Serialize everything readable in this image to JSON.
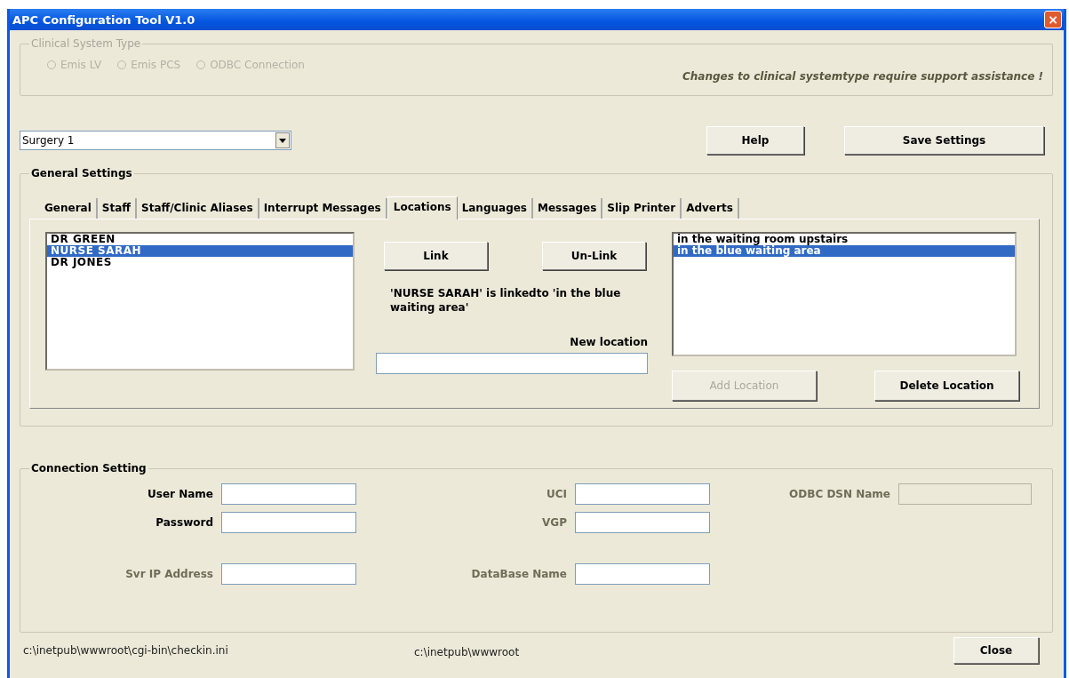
{
  "window": {
    "title": "APC Configuration Tool V1.0",
    "close": "×"
  },
  "clinical_system_type": {
    "legend": "Clinical System Type",
    "options": [
      {
        "label": "Emis LV",
        "selected": false,
        "disabled": true
      },
      {
        "label": "Emis PCS",
        "selected": false,
        "disabled": true
      },
      {
        "label": "ODBC Connection",
        "selected": false,
        "disabled": true
      }
    ],
    "note": "Changes to clinical systemtype require support assistance !"
  },
  "surgery": {
    "value": "Surgery 1"
  },
  "buttons": [
    {
      "label": "Help",
      "disabled": false
    },
    {
      "label": "Save Settings",
      "disabled": false
    }
  ],
  "general_settings": {
    "legend": "General Settings",
    "tabs": [
      {
        "label": "General",
        "selected": false
      },
      {
        "label": "Staff",
        "selected": false
      },
      {
        "label": "Staff/Clinic Aliases",
        "selected": false
      },
      {
        "label": "Interrupt Messages",
        "selected": false
      },
      {
        "label": "Locations",
        "selected": true
      },
      {
        "label": "Languages",
        "selected": false
      },
      {
        "label": "Messages",
        "selected": false
      },
      {
        "label": "Slip Printer",
        "selected": false
      },
      {
        "label": "Adverts",
        "selected": false
      }
    ],
    "staff": [
      {
        "label": "DR GREEN",
        "selected": false
      },
      {
        "label": "NURSE SARAH",
        "selected": true
      },
      {
        "label": "DR JONES",
        "selected": false
      }
    ],
    "link_buttons": [
      {
        "label": "Link",
        "disabled": false
      },
      {
        "label": "Un-Link",
        "disabled": false
      }
    ],
    "link_message": "'NURSE SARAH' is linkedto 'in the blue waiting area'",
    "new_location_label": "New location",
    "locations": [
      {
        "label": "in the waiting room upstairs",
        "selected": false
      },
      {
        "label": "in the blue waiting area",
        "selected": true
      }
    ],
    "location_buttons": [
      {
        "label": "Add Location",
        "disabled": true
      },
      {
        "label": "Delete Location",
        "disabled": false
      }
    ]
  },
  "connection_setting": {
    "legend": "Connection Setting",
    "rows": [
      {
        "fields": [
          {
            "label": "User Name",
            "disabled": false
          },
          {
            "label": "UCI",
            "disabled": true
          },
          {
            "label": "ODBC DSN Name",
            "disabled": true,
            "field_disabled": true
          }
        ]
      },
      {
        "fields": [
          {
            "label": "Password",
            "disabled": false
          },
          {
            "label": "VGP",
            "disabled": true
          }
        ]
      },
      {
        "fields": [
          {
            "label": "Svr IP Address",
            "disabled": true
          },
          {
            "label": "DataBase Name",
            "disabled": true
          }
        ]
      }
    ]
  },
  "status": {
    "ini_path": "c:\\inetpub\\wwwroot\\cgi-bin\\checkin.ini",
    "root_path": "c:\\inetpub\\wwwroot"
  },
  "close_button": {
    "label": "Close",
    "disabled": false
  }
}
